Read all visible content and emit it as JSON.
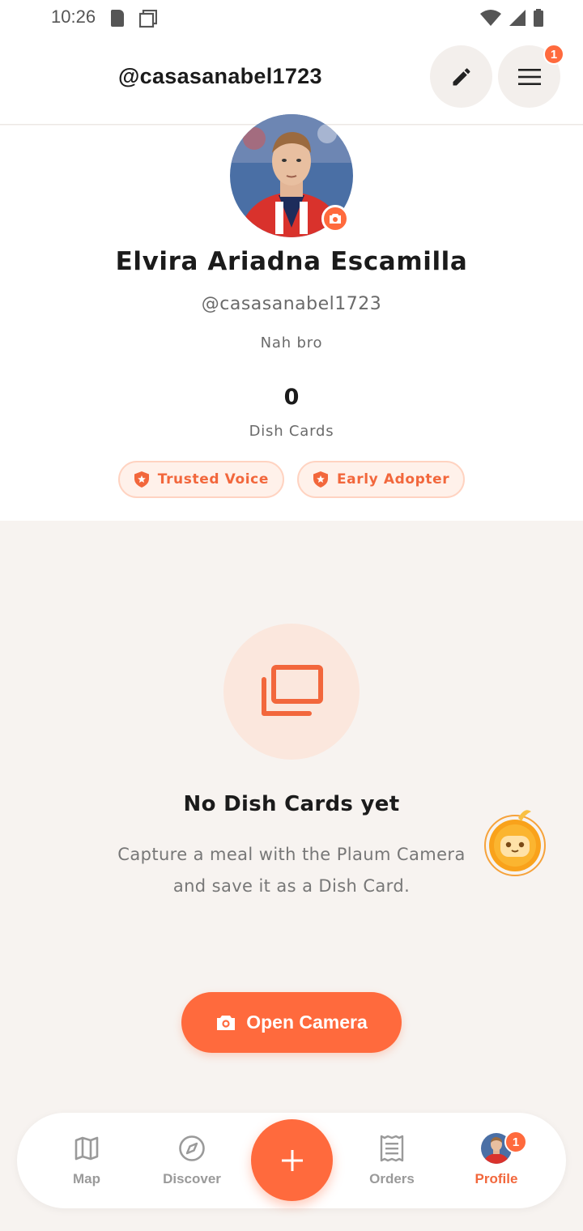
{
  "status_bar": {
    "time": "10:26"
  },
  "header": {
    "handle": "@casasanabel1723",
    "menu_badge": "1"
  },
  "profile": {
    "name": "Elvira Ariadna Escamilla",
    "handle": "@casasanabel1723",
    "bio": "Nah bro",
    "dish_cards_count": "0",
    "dish_cards_label": "Dish Cards",
    "badges": [
      {
        "label": "Trusted Voice"
      },
      {
        "label": "Early Adopter"
      }
    ]
  },
  "empty_state": {
    "title": "No Dish Cards yet",
    "description": "Capture a meal with the Plaum Camera and save it as a Dish Card.",
    "button_label": "Open Camera"
  },
  "bottom_nav": {
    "items": [
      {
        "label": "Map",
        "icon": "map-icon"
      },
      {
        "label": "Discover",
        "icon": "compass-icon"
      },
      {
        "label": "Orders",
        "icon": "receipt-icon"
      },
      {
        "label": "Profile",
        "icon": "avatar",
        "active": true
      }
    ],
    "profile_badge": "1"
  },
  "colors": {
    "accent": "#FF6A3D",
    "background": "#F7F3F0"
  }
}
